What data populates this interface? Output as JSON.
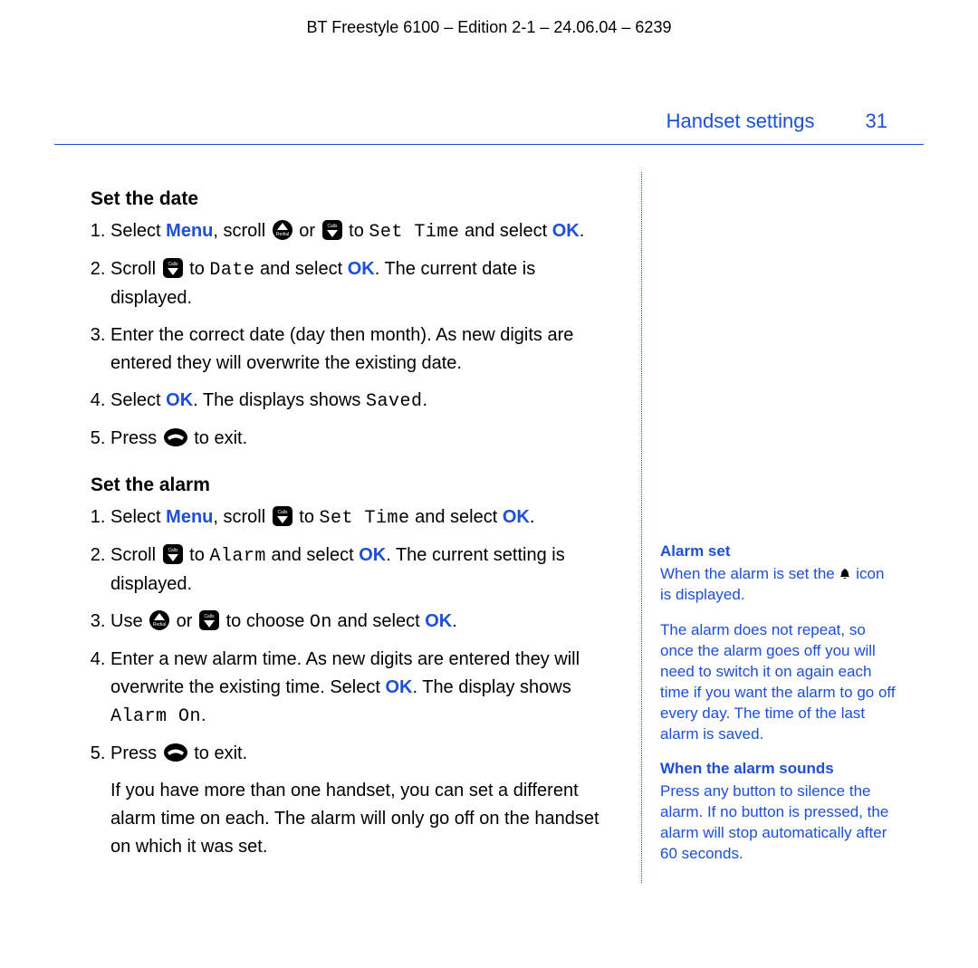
{
  "document": {
    "header": "BT Freestyle 6100 – Edition 2-1 – 24.06.04 – 6239",
    "section_title": "Handset settings",
    "page_number": "31"
  },
  "labels": {
    "menu": "Menu",
    "ok": "OK"
  },
  "lcd": {
    "set_time": "Set Time",
    "date": "Date",
    "saved": "Saved",
    "alarm": "Alarm",
    "on": "On",
    "alarm_on": "Alarm On"
  },
  "set_date": {
    "heading": "Set the date",
    "s1a": "Select ",
    "s1b": ", scroll ",
    "s1c": " or ",
    "s1d": " to ",
    "s1e": " and select ",
    "s1f": ".",
    "s2a": "Scroll ",
    "s2b": " to ",
    "s2c": " and select ",
    "s2d": ". The current date is displayed.",
    "s3": "Enter the correct date (day then month). As new digits are entered they will overwrite the existing date.",
    "s4a": "Select ",
    "s4b": ". The displays shows ",
    "s4c": ".",
    "s5a": "Press ",
    "s5b": " to exit."
  },
  "set_alarm": {
    "heading": "Set the alarm",
    "s1a": "Select ",
    "s1b": ", scroll ",
    "s1c": " to ",
    "s1d": " and select ",
    "s1e": ".",
    "s2a": "Scroll ",
    "s2b": " to ",
    "s2c": " and select ",
    "s2d": ". The current setting is displayed.",
    "s3a": "Use ",
    "s3b": " or ",
    "s3c": " to choose ",
    "s3d": " and select ",
    "s3e": ".",
    "s4a": "Enter a new alarm time. As new digits are entered they will overwrite the existing time. Select ",
    "s4b": ". The display shows ",
    "s4c": ".",
    "s5a": "Press ",
    "s5b": " to exit.",
    "note": "If you have more than one handset, you can set a different alarm time on each. The alarm will only go off on the handset on which it was set."
  },
  "sidebar": {
    "h1": "Alarm set",
    "p1a": "When the alarm is set the ",
    "p1b": " icon is displayed.",
    "p2": "The alarm does not repeat, so once the alarm goes off you will need to switch it on again each time if you want the alarm to go off every day. The time of the last alarm is saved.",
    "h2": "When the alarm sounds",
    "p3": "Press any button to silence the alarm. If no button is pressed, the alarm will stop automatically after 60 seconds."
  }
}
